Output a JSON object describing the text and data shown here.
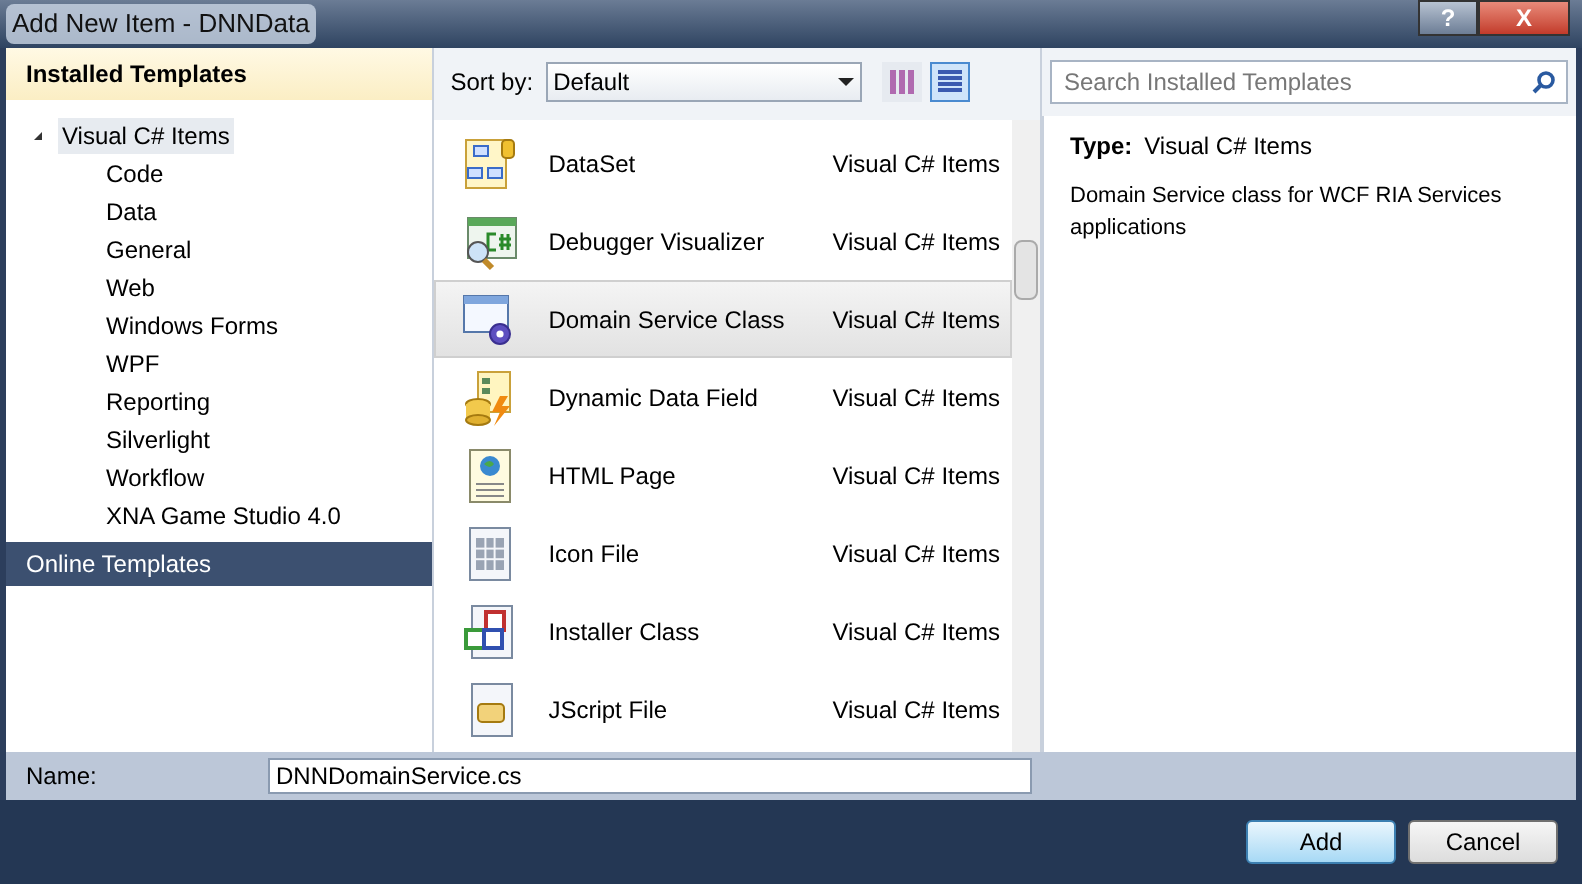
{
  "window": {
    "title": "Add New Item - DNNData",
    "buttons": [
      {
        "kind": "help",
        "label": "?"
      },
      {
        "kind": "close",
        "label": "X"
      }
    ]
  },
  "sidebar": {
    "header": "Installed Templates",
    "tree": [
      {
        "label": "Visual C# Items",
        "expanded": true,
        "selected": true,
        "children": [
          {
            "label": "Code"
          },
          {
            "label": "Data"
          },
          {
            "label": "General"
          },
          {
            "label": "Web"
          },
          {
            "label": "Windows Forms"
          },
          {
            "label": "WPF"
          },
          {
            "label": "Reporting"
          },
          {
            "label": "Silverlight"
          },
          {
            "label": "Workflow"
          },
          {
            "label": "XNA Game Studio 4.0"
          }
        ]
      }
    ],
    "online": "Online Templates"
  },
  "toolbar": {
    "sort_label": "Sort by:",
    "sort_value": "Default",
    "views": [
      {
        "kind": "medium",
        "selected": false
      },
      {
        "kind": "small",
        "selected": true
      }
    ]
  },
  "templates": [
    {
      "kind": "dataset",
      "name": "DataSet",
      "category": "Visual C# Items",
      "selected": false
    },
    {
      "kind": "debugger",
      "name": "Debugger Visualizer",
      "category": "Visual C# Items",
      "selected": false
    },
    {
      "kind": "service",
      "name": "Domain Service Class",
      "category": "Visual C# Items",
      "selected": true
    },
    {
      "kind": "dynamic",
      "name": "Dynamic Data Field",
      "category": "Visual C# Items",
      "selected": false
    },
    {
      "kind": "html",
      "name": "HTML Page",
      "category": "Visual C# Items",
      "selected": false
    },
    {
      "kind": "iconfile",
      "name": "Icon File",
      "category": "Visual C# Items",
      "selected": false
    },
    {
      "kind": "installer",
      "name": "Installer Class",
      "category": "Visual C# Items",
      "selected": false
    },
    {
      "kind": "script",
      "name": "JScript File",
      "category": "Visual C# Items",
      "selected": false
    }
  ],
  "search": {
    "placeholder": "Search Installed Templates"
  },
  "details": {
    "type_label": "Type:",
    "type_value": "Visual C# Items",
    "description": "Domain Service class for WCF RIA Services applications"
  },
  "name_field": {
    "label": "Name:",
    "value": "DNNDomainService.cs"
  },
  "buttons": [
    {
      "label": "Add",
      "default": true
    },
    {
      "label": "Cancel",
      "default": false
    }
  ]
}
